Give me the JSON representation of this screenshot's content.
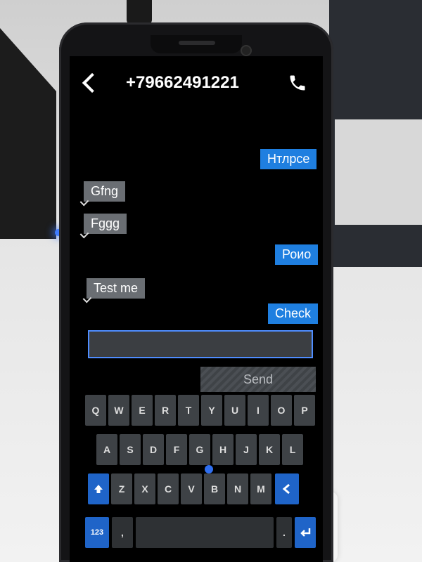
{
  "header": {
    "title": "+79662491221",
    "back_icon": "chevron-left-icon",
    "call_icon": "phone-icon"
  },
  "messages": [
    {
      "direction": "out",
      "text": "Нтлрсе"
    },
    {
      "direction": "in",
      "text": "Gfng"
    },
    {
      "direction": "in",
      "text": "Fggg"
    },
    {
      "direction": "out",
      "text": "Роио"
    },
    {
      "direction": "in",
      "text": "Test me"
    },
    {
      "direction": "out",
      "text": "Check"
    }
  ],
  "composer": {
    "value": "",
    "send_label": "Send"
  },
  "keyboard": {
    "row1": [
      "Q",
      "W",
      "E",
      "R",
      "T",
      "Y",
      "U",
      "I",
      "O",
      "P"
    ],
    "row2": [
      "A",
      "S",
      "D",
      "F",
      "G",
      "H",
      "J",
      "K",
      "L"
    ],
    "row3": [
      "Z",
      "X",
      "C",
      "V",
      "B",
      "N",
      "M"
    ],
    "numbers_label": "123",
    "comma_label": ",",
    "period_label": "."
  },
  "colors": {
    "out_bubble": "#1f7fe0",
    "in_bubble": "#6a6e73",
    "input_border": "#4f8dff",
    "keyboard_accent": "#1f64c8"
  }
}
